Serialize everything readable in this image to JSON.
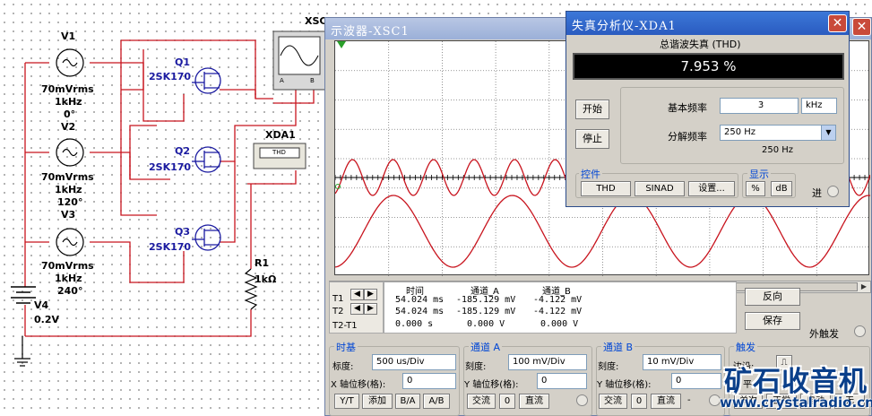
{
  "schematic": {
    "sources": [
      {
        "name": "V1",
        "amplitude": "70mVrms",
        "freq": "1kHz",
        "phase": "0°"
      },
      {
        "name": "V2",
        "amplitude": "70mVrms",
        "freq": "1kHz",
        "phase": "120°"
      },
      {
        "name": "V3",
        "amplitude": "70mVrms",
        "freq": "1kHz",
        "phase": "240°"
      }
    ],
    "battery": {
      "name": "V4",
      "value": "0.2V"
    },
    "transistors": [
      {
        "name": "Q1",
        "model": "2SK170"
      },
      {
        "name": "Q2",
        "model": "2SK170"
      },
      {
        "name": "Q3",
        "model": "2SK170"
      }
    ],
    "resistor": {
      "name": "R1",
      "value": "1kΩ"
    },
    "xda_label": "XDA1",
    "xda_display": "THD",
    "xsc_label": "XSC",
    "xsc_channel_a": "A",
    "xsc_channel_b": "B"
  },
  "oscilloscope": {
    "title": "示波器-XSC1",
    "readout": {
      "headers": {
        "time": "时间",
        "ch_a": "通道_A",
        "ch_b": "通道_B"
      },
      "rows": [
        {
          "label": "T1",
          "time": "54.024 ms",
          "ch_a": "-185.129 mV",
          "ch_b": "-4.122 mV"
        },
        {
          "label": "T2",
          "time": "54.024 ms",
          "ch_a": "-185.129 mV",
          "ch_b": "-4.122 mV"
        },
        {
          "label": "T2-T1",
          "time": "0.000 s",
          "ch_a": "0.000 V",
          "ch_b": "0.000 V"
        }
      ]
    },
    "buttons": {
      "reverse": "反向",
      "save": "保存",
      "ext_trigger": "外触发"
    },
    "timebase": {
      "title": "时基",
      "scale_label": "标度:",
      "scale_value": "500 us/Div",
      "xpos_label": "X 轴位移(格):",
      "xpos_value": "0",
      "yt": "Y/T",
      "add": "添加",
      "ba": "B/A",
      "ab": "A/B"
    },
    "channel_a": {
      "title": "通道 A",
      "scale_label": "刻度:",
      "scale_value": "100 mV/Div",
      "ypos_label": "Y 轴位移(格):",
      "ypos_value": "0",
      "ac": "交流",
      "zero": "0",
      "dc": "直流"
    },
    "channel_b": {
      "title": "通道 B",
      "scale_label": "刻度:",
      "scale_value": "10 mV/Div",
      "ypos_label": "Y 轴位移(格):",
      "ypos_value": "0",
      "ac": "交流",
      "zero": "0",
      "dc": "直流",
      "minus": "-"
    },
    "trigger": {
      "title": "触发",
      "edge_label": "边沿:",
      "level_label": "平",
      "single": "单次",
      "normal": "正常",
      "auto": "自动",
      "none": "无"
    },
    "trace_a_color": "#c8141e",
    "trace_b_color": "#c8141e"
  },
  "distortion_analyzer": {
    "title": "失真分析仪-XDA1",
    "thd_title": "总谐波失真 (THD)",
    "thd_value": "7.953 %",
    "start_label": "开始",
    "stop_label": "停止",
    "fundamental_label": "基本频率",
    "fundamental_value": "3",
    "fundamental_unit": "kHz",
    "resolution_label": "分解频率",
    "resolution_value": "250 Hz",
    "resolution_readout": "250 Hz",
    "controls_title": "控件",
    "thd_btn": "THD",
    "sinad_btn": "SINAD",
    "settings_btn": "设置...",
    "display_title": "显示",
    "percent_btn": "%",
    "db_btn": "dB",
    "in_label": "进"
  },
  "watermark": {
    "line1": "矿石收音机",
    "line2": "www.crystalradio.cn"
  },
  "colors": {
    "wire": "#c8141e",
    "component": "#1a1aa0",
    "titlebar_active": "#2a5bc0",
    "close": "#c94a3a"
  }
}
